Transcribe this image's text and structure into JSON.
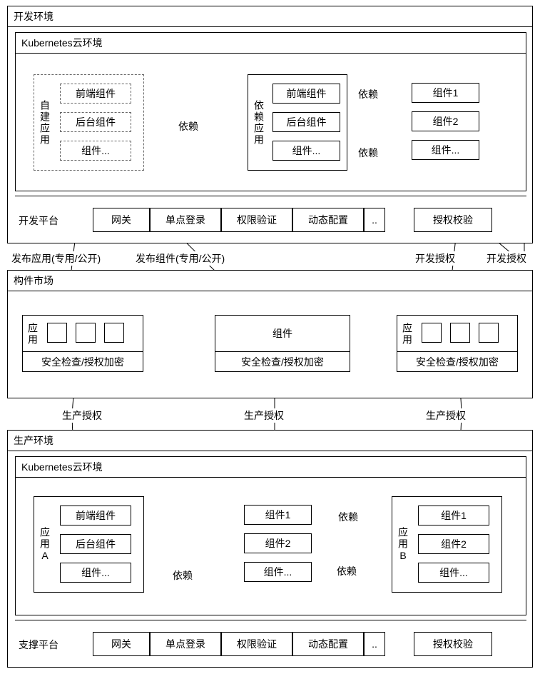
{
  "dev_env": {
    "title": "开发环境",
    "k8s_title": "Kubernetes云环境",
    "self_app": {
      "label": "自建应用",
      "items": [
        "前端组件",
        "后台组件",
        "组件..."
      ]
    },
    "dep_app": {
      "label": "依赖应用",
      "items": [
        "前端组件",
        "后台组件",
        "组件..."
      ]
    },
    "dep_right": {
      "items": [
        "组件1",
        "组件2",
        "组件..."
      ]
    },
    "dep_edge_label": "依赖",
    "platform_label": "开发平台",
    "platform_items": [
      "网关",
      "单点登录",
      "权限验证",
      "动态配置",
      "..",
      "授权校验"
    ]
  },
  "market": {
    "title": "构件市场",
    "app_left_label": "应用",
    "component_label": "组件",
    "app_right_label": "应用",
    "security_label": "安全检查/授权加密",
    "publish_app_label": "发布应用(专用/公开)",
    "publish_comp_label": "发布组件(专用/公开)",
    "dev_auth_label": "开发授权",
    "prod_auth_label": "生产授权"
  },
  "prod_env": {
    "title": "生产环境",
    "k8s_title": "Kubernetes云环境",
    "app_a": {
      "label": "应用A",
      "items": [
        "前端组件",
        "后台组件",
        "组件..."
      ]
    },
    "middle": {
      "items": [
        "组件1",
        "组件2",
        "组件..."
      ]
    },
    "app_b": {
      "label": "应用B",
      "items": [
        "组件1",
        "组件2",
        "组件..."
      ]
    },
    "dep_edge_label": "依赖",
    "platform_label": "支撑平台",
    "platform_items": [
      "网关",
      "单点登录",
      "权限验证",
      "动态配置",
      "..",
      "授权校验"
    ]
  }
}
